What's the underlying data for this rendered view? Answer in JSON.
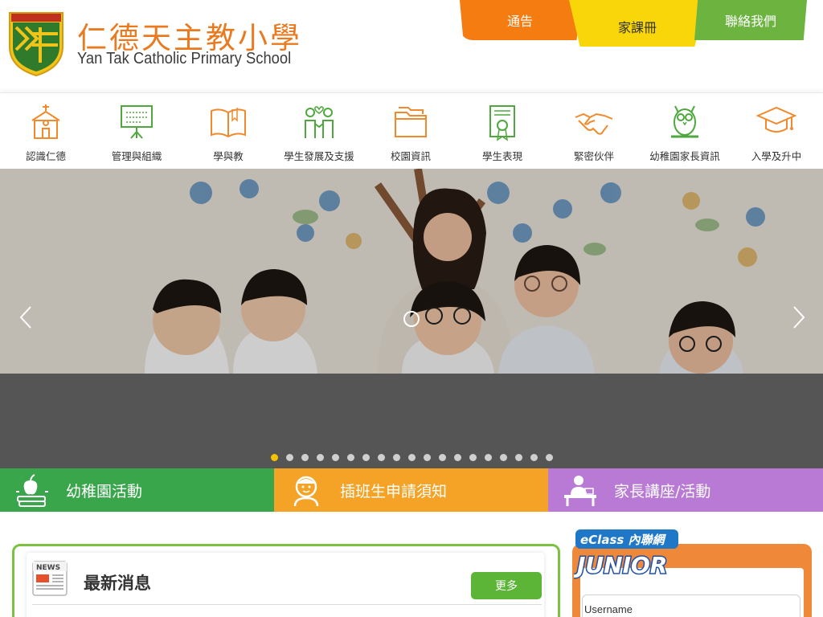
{
  "header": {
    "school_name_cn": "仁德天主教小學",
    "school_name_en": "Yan Tak Catholic Primary School",
    "logo_text": "仁德天主教小學",
    "top_tabs": {
      "notice": "通告",
      "homework": "家課冊",
      "contact": "聯絡我們"
    }
  },
  "nav": {
    "items": [
      {
        "label": "認識仁德",
        "icon": "church-icon"
      },
      {
        "label": "管理與組織",
        "icon": "presentation-board-icon"
      },
      {
        "label": "學與教",
        "icon": "open-book-icon"
      },
      {
        "label": "學生發展及支援",
        "icon": "children-heart-icon"
      },
      {
        "label": "校園資訊",
        "icon": "folders-icon"
      },
      {
        "label": "學生表現",
        "icon": "certificate-icon"
      },
      {
        "label": "緊密伙伴",
        "icon": "handshake-icon"
      },
      {
        "label": "幼稚園家長資訊",
        "icon": "owl-icon"
      },
      {
        "label": "入學及升中",
        "icon": "graduation-cap-icon"
      }
    ]
  },
  "slider": {
    "slide_count": 19,
    "active_index": 0
  },
  "quick_links": [
    {
      "label": "幼稚園活動",
      "icon": "apple-books-icon",
      "color": "#3aa64c"
    },
    {
      "label": "插班生申請須知",
      "icon": "student-face-icon",
      "color": "#f4a326"
    },
    {
      "label": "家長講座/活動",
      "icon": "teacher-desk-icon",
      "color": "#b97ad6"
    }
  ],
  "news": {
    "icon_label": "NEWS",
    "title": "最新消息",
    "more_button": "更多"
  },
  "eclass": {
    "logo_top": "eClass 內聯網",
    "logo_bottom": "JUNIOR",
    "username_label": "Username"
  },
  "colors": {
    "brand_orange": "#ea7a20",
    "nav_icon_orange": "#f08a2c",
    "nav_icon_green": "#4fa83d",
    "news_border": "#7cc142",
    "eclass_panel": "#f0883a"
  }
}
